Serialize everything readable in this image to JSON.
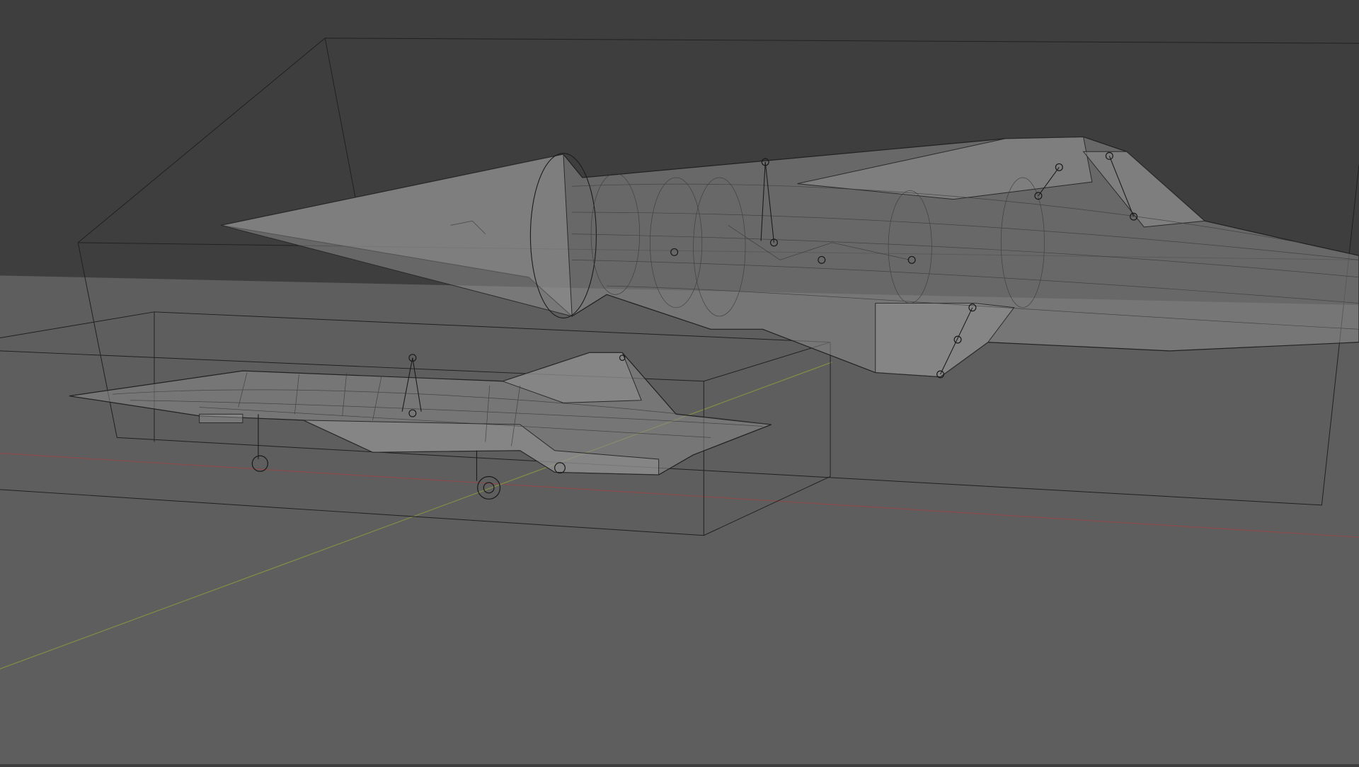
{
  "viewport": {
    "mode": "wireframe",
    "colors": {
      "background": "#3e3e3e",
      "floor": "#5e5e5e",
      "x_axis": "#8a4a4a",
      "y_axis": "#7f8f45",
      "wire": "#1c1c1c"
    }
  },
  "objects": [
    {
      "name": "aircraft-large",
      "bounding_box": true
    },
    {
      "name": "aircraft-small",
      "bounding_box": true,
      "landing_gear": true
    }
  ]
}
